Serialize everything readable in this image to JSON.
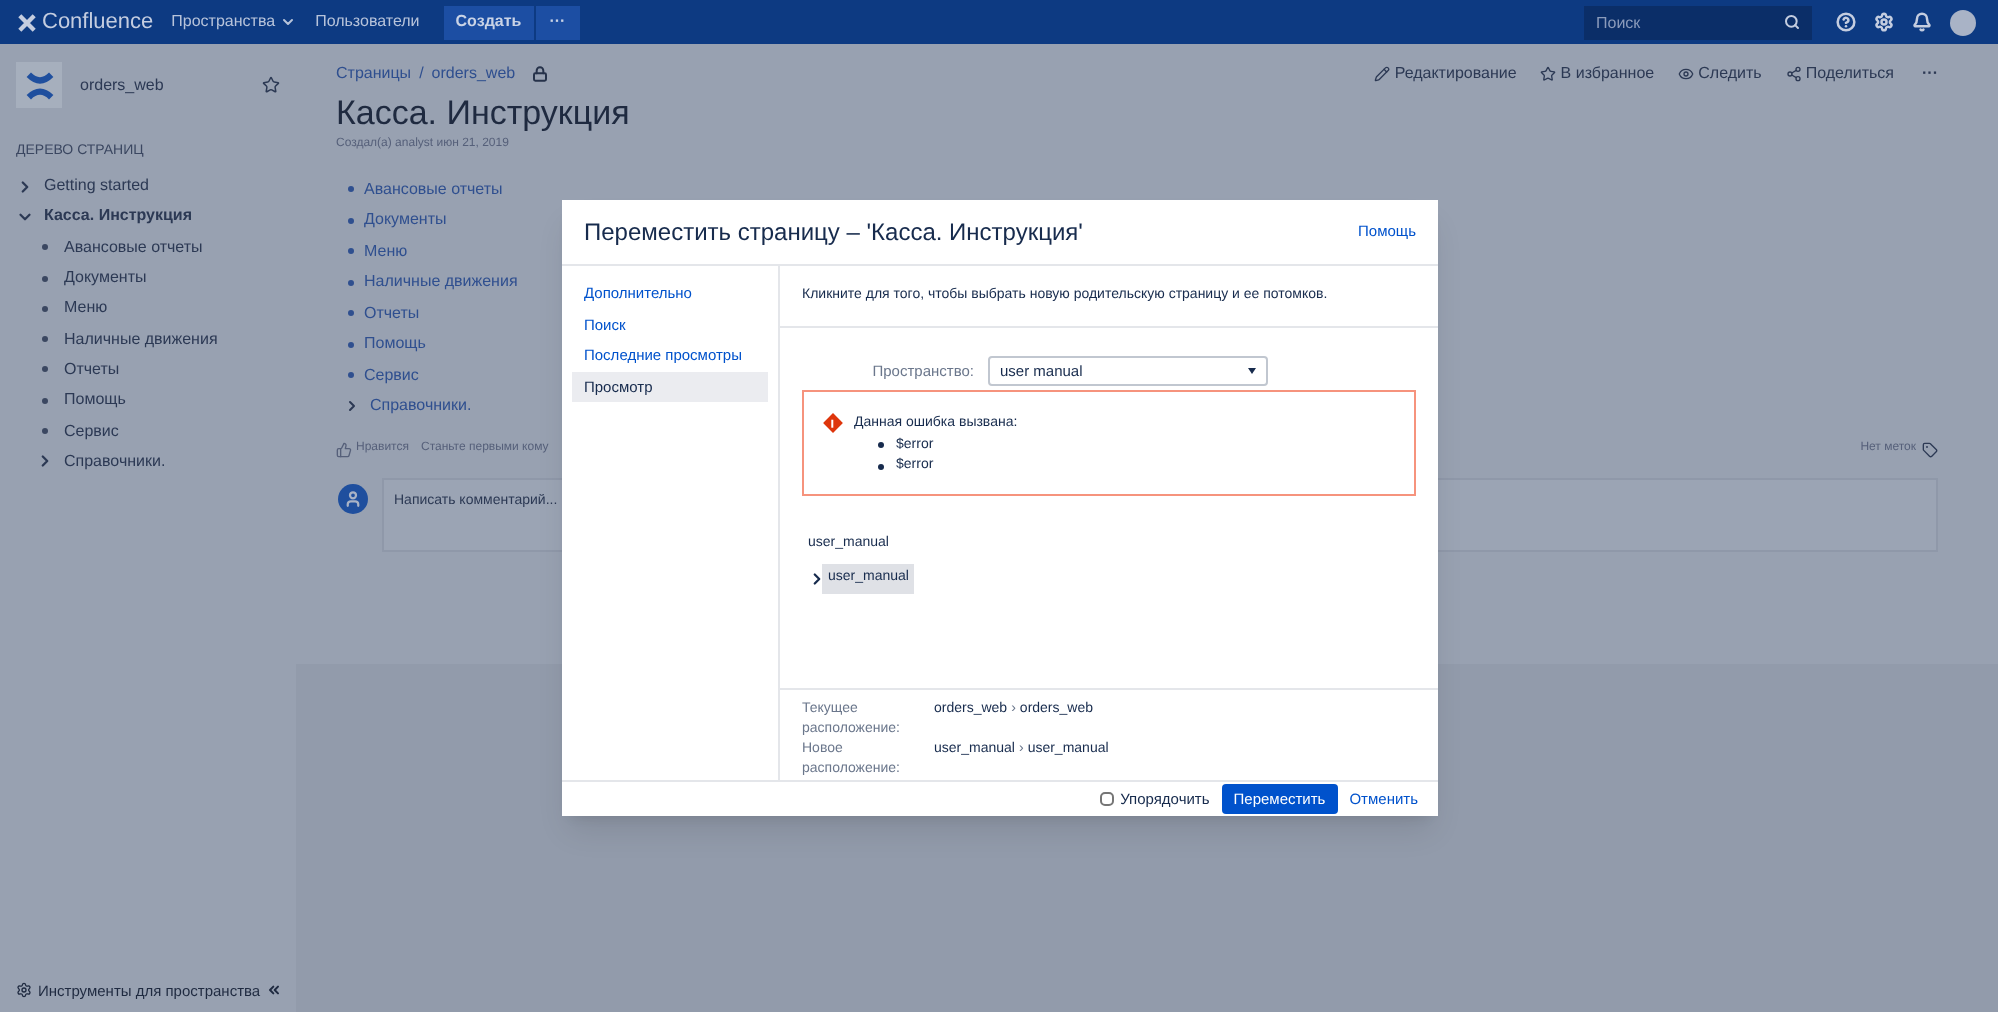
{
  "nav": {
    "logo": "Confluence",
    "menu": [
      {
        "label": "Пространства",
        "dropdown": true
      },
      {
        "label": "Пользователи",
        "dropdown": false
      }
    ],
    "create": "Создать",
    "more": "···",
    "search": {
      "placeholder": "Поиск"
    }
  },
  "sidebar": {
    "space": "orders_web",
    "tree_title": "ДЕРЕВО СТРАНИЦ",
    "tree": [
      {
        "label": "Getting started",
        "kind": "branch",
        "expanded": false,
        "selected": false
      },
      {
        "label": "Касса. Инструкция",
        "kind": "branch",
        "expanded": true,
        "selected": true,
        "children": [
          {
            "label": "Авансовые отчеты",
            "kind": "leaf",
            "selected": false
          },
          {
            "label": "Документы",
            "kind": "leaf",
            "selected": false
          },
          {
            "label": "Меню",
            "kind": "leaf",
            "selected": false
          },
          {
            "label": "Наличные движения",
            "kind": "leaf",
            "selected": false
          },
          {
            "label": "Отчеты",
            "kind": "leaf",
            "selected": false
          },
          {
            "label": "Помощь",
            "kind": "leaf",
            "selected": false
          },
          {
            "label": "Сервис",
            "kind": "leaf",
            "selected": false
          },
          {
            "label": "Справочники.",
            "kind": "branch",
            "expanded": false,
            "selected": false
          }
        ]
      }
    ],
    "tools": "Инструменты для пространства"
  },
  "page": {
    "breadcrumbs": [
      "Страницы",
      "orders_web"
    ],
    "breadcrumb_separator": "/",
    "actions": [
      {
        "label": "Редактирование",
        "kind": "edit"
      },
      {
        "label": "В избранное",
        "kind": "star"
      },
      {
        "label": "Следить",
        "kind": "watch"
      },
      {
        "label": "Поделиться",
        "kind": "share"
      }
    ],
    "more": "···",
    "title": "Касса. Инструкция",
    "byline": "Создал(а) analyst июн 21, 2019",
    "links": [
      {
        "label": "Авансовые отчеты",
        "kind": "leaf"
      },
      {
        "label": "Документы",
        "kind": "leaf"
      },
      {
        "label": "Меню",
        "kind": "leaf"
      },
      {
        "label": "Наличные движения",
        "kind": "leaf"
      },
      {
        "label": "Отчеты",
        "kind": "leaf"
      },
      {
        "label": "Помощь",
        "kind": "leaf"
      },
      {
        "label": "Сервис",
        "kind": "leaf"
      },
      {
        "label": "Справочники.",
        "kind": "branch"
      }
    ],
    "like": "Нравится",
    "like_hint": "Станьте первыми кому",
    "labels": "Нет меток",
    "comment": {
      "placeholder": "Написать комментарий..."
    }
  },
  "dialog": {
    "title": "Переместить страницу – 'Касса. Инструкция'",
    "help": "Помощь",
    "nav": [
      {
        "label": "Дополнительно",
        "selected": false
      },
      {
        "label": "Поиск",
        "selected": false
      },
      {
        "label": "Последние просмотры",
        "selected": false
      },
      {
        "label": "Просмотр",
        "selected": true
      }
    ],
    "instruction": "Кликните для того, чтобы выбрать новую родительскую страницу и ее потомков.",
    "space_label": "Пространство:",
    "space_value": "user manual",
    "error": {
      "title": "Данная ошибка вызвана:",
      "items": [
        "$error",
        "$error"
      ]
    },
    "tree": {
      "root": "user_manual",
      "children": [
        {
          "label": "user_manual",
          "selected": true,
          "expanded": false
        }
      ]
    },
    "path_separator": "›",
    "locations": [
      {
        "label": "Текущее расположение:",
        "path": [
          "orders_web",
          "orders_web"
        ]
      },
      {
        "label": "Новое расположение:",
        "path": [
          "user_manual",
          "user_manual"
        ]
      }
    ],
    "reorder": {
      "label": "Упорядочить",
      "checked": false
    },
    "submit": "Переместить",
    "cancel": "Отменить"
  }
}
